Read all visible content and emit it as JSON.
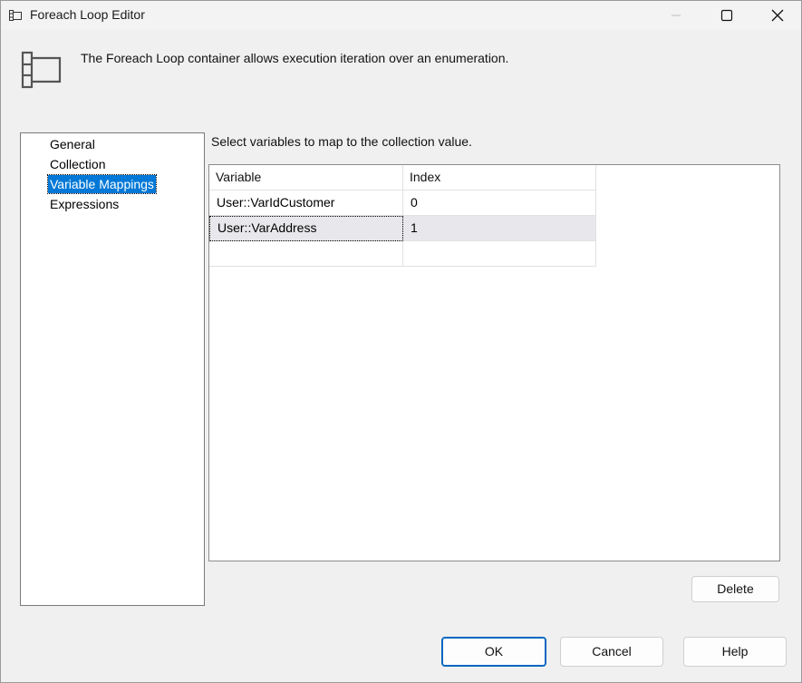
{
  "window": {
    "title": "Foreach Loop Editor",
    "icon": "foreach-loop-icon",
    "controls": {
      "minimize": "minimize-icon",
      "maximize": "maximize-icon",
      "close": "close-icon"
    }
  },
  "header": {
    "icon": "foreach-loop-container-icon",
    "description": "The Foreach Loop container allows execution iteration over an enumeration."
  },
  "nav": {
    "items": [
      {
        "label": "General"
      },
      {
        "label": "Collection"
      },
      {
        "label": "Variable Mappings",
        "selected": true
      },
      {
        "label": "Expressions"
      }
    ]
  },
  "main": {
    "instruction": "Select variables to map to the collection value.",
    "table": {
      "columns": [
        "Variable",
        "Index"
      ],
      "rows": [
        {
          "variable": "User::VarIdCustomer",
          "index": "0"
        },
        {
          "variable": "User::VarAddress",
          "index": "1"
        },
        {
          "variable": "",
          "index": ""
        }
      ]
    },
    "delete_label": "Delete"
  },
  "footer": {
    "ok_label": "OK",
    "cancel_label": "Cancel",
    "help_label": "Help"
  },
  "colors": {
    "selection": "#0078d7",
    "selected_row": "#e8e8ec",
    "default_button_border": "#0067c0"
  }
}
